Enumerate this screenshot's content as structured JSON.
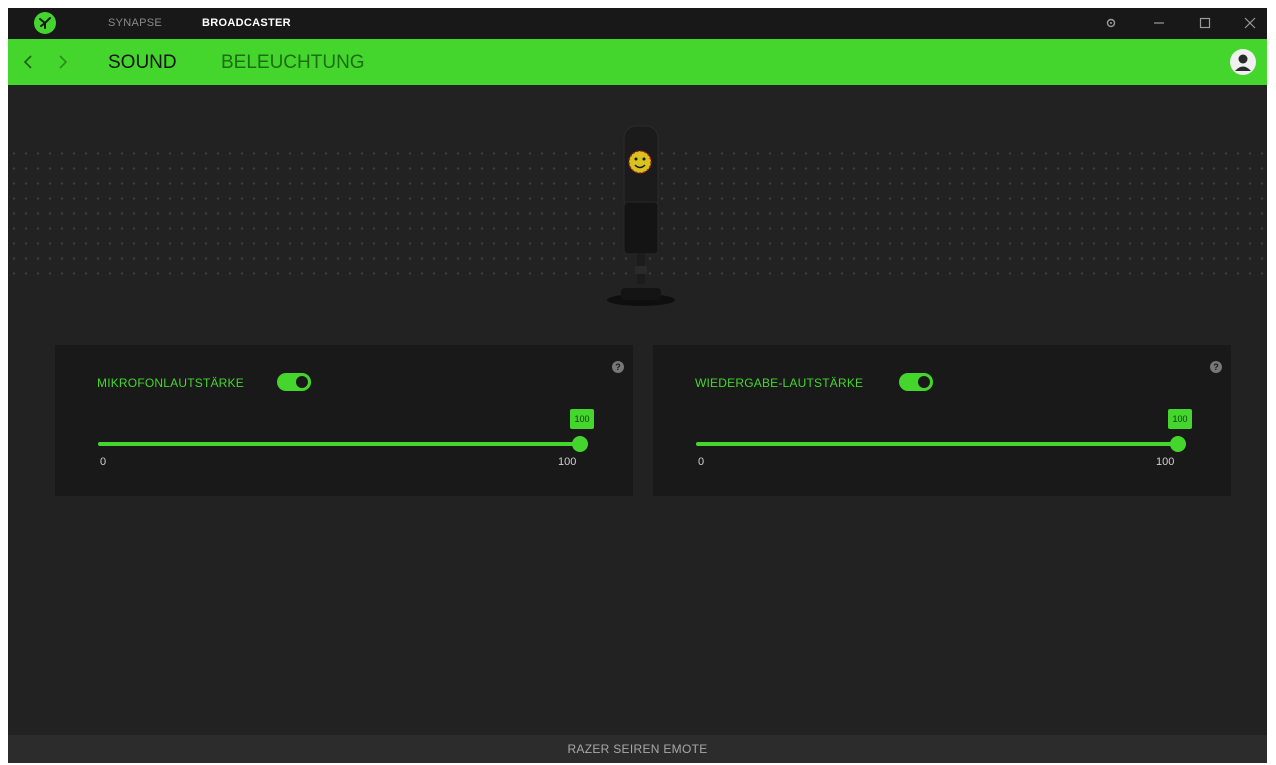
{
  "window": {
    "top_tabs": [
      "SYNAPSE",
      "BROADCASTER"
    ],
    "active_top_tab": "BROADCASTER",
    "controls": [
      "settings-icon",
      "minimize-icon",
      "maximize-icon",
      "close-icon"
    ]
  },
  "header": {
    "tabs": [
      "SOUND",
      "BELEUCHTUNG"
    ],
    "active_tab": "SOUND",
    "nav": [
      "back-icon",
      "forward-icon"
    ],
    "avatar_icon": "user-avatar-icon"
  },
  "panels": [
    {
      "label": "MIKROFONLAUTSTÄRKE",
      "toggle_on": true,
      "value": "100",
      "value_fraction": 1.0,
      "min": "0",
      "max": "100",
      "help": "?"
    },
    {
      "label": "WIEDERGABE-LAUTSTÄRKE",
      "toggle_on": true,
      "value": "100",
      "value_fraction": 1.0,
      "min": "0",
      "max": "100",
      "help": "?"
    }
  ],
  "footer": {
    "device_name": "RAZER SEIREN EMOTE"
  },
  "colors": {
    "accent": "#44d62c",
    "background": "#222222",
    "panel": "#191919",
    "titlebar": "#181818"
  }
}
